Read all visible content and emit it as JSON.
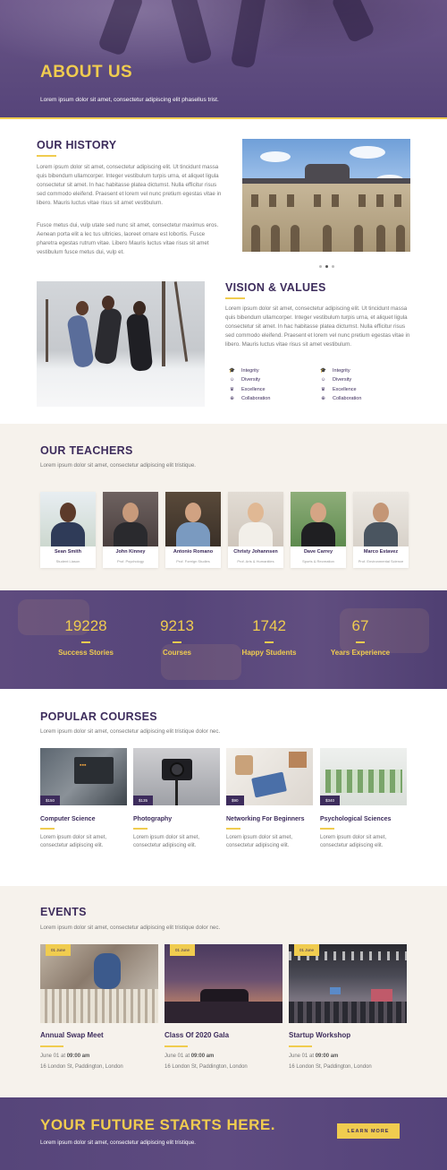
{
  "colors": {
    "accent": "#f0cc4f",
    "brand": "#3d2c5c"
  },
  "hero": {
    "title": "ABOUT US",
    "subtitle": "Lorem ipsum dolor sit amet, consectetur adipiscing elit phasellus trist."
  },
  "history": {
    "title": "OUR HISTORY",
    "p1": "Lorem ipsum dolor sit amet, consectetur adipiscing elit. Ut tincidunt massa quis bibendum ullamcorper. Integer vestibulum turpis urna, et aliquet ligula consectetur sit amet. In hac habitasse platea dictumst. Nulla efficitur risus sed commodo eleifend. Praesent et lorem vel nunc pretium egestas vitae in libero. Mauris luctus vitae risus sit amet vestibulum.",
    "p2": "Fusce metus dui, vulp utate sed nunc sit amet, consectetur maximus eros. Aenean porta elit a lec tus ultricies, laoreet ornare est lobortis. Fusce pharetra egestas rutrum vitae. Libero Mauris luctus vitae risus sit amet vestibulum fusce metus dui, vulp et."
  },
  "vision": {
    "title": "VISION & VALUES",
    "text": "Lorem ipsum dolor sit amet, consectetur adipiscing elit. Ut tincidunt massa quis bibendum ullamcorper. Integer vestibulum turpis urna, et aliquet ligula consectetur sit amet. In hac habitasse platea dictumst. Nulla efficitur risus sed commodo eleifend. Praesent et lorem vel nunc pretium egestas vitae in libero. Mauris luctus vitae risus sit amet vestibulum.",
    "values_left": [
      {
        "icon": "graduation-cap-icon",
        "label": "Integrity"
      },
      {
        "icon": "users-icon",
        "label": "Diversity"
      },
      {
        "icon": "trophy-icon",
        "label": "Excellence"
      },
      {
        "icon": "compass-icon",
        "label": "Collaboration"
      }
    ],
    "values_right": [
      {
        "icon": "graduation-cap-icon",
        "label": "Integrity"
      },
      {
        "icon": "users-icon",
        "label": "Diversity"
      },
      {
        "icon": "trophy-icon",
        "label": "Excellence"
      },
      {
        "icon": "compass-icon",
        "label": "Collaboration"
      }
    ]
  },
  "teachers": {
    "title": "OUR TEACHERS",
    "subtitle": "Lorem ipsum dolor sit amet, consectetur adipiscing elit tristique.",
    "items": [
      {
        "name": "Sean Smith",
        "role": "Student Liason"
      },
      {
        "name": "John Kinney",
        "role": "Prof. Psychology"
      },
      {
        "name": "Antonio Romano",
        "role": "Prof. Foreign Studies"
      },
      {
        "name": "Christy Johannsen",
        "role": "Prof. Arts & Humanities"
      },
      {
        "name": "Dave Carrey",
        "role": "Sports & Recreation"
      },
      {
        "name": "Marco Estavez",
        "role": "Prof. Environmental Science"
      }
    ]
  },
  "stats": [
    {
      "number": "19228",
      "label": "Success Stories"
    },
    {
      "number": "9213",
      "label": "Courses"
    },
    {
      "number": "1742",
      "label": "Happy Students"
    },
    {
      "number": "67",
      "label": "Years Experience"
    }
  ],
  "courses": {
    "title": "POPULAR COURSES",
    "subtitle": "Lorem ipsum dolor sit amet, consectetur adipiscing elit tristique dolor nec.",
    "items": [
      {
        "price": "$150",
        "title": "Computer Science",
        "desc": "Lorem ipsum dolor sit amet, consectetur adipiscing elit."
      },
      {
        "price": "$135",
        "title": "Photography",
        "desc": "Lorem ipsum dolor sit amet, consectetur adipiscing elit."
      },
      {
        "price": "$90",
        "title": "Networking For Beginners",
        "desc": "Lorem ipsum dolor sit amet, consectetur adipiscing elit."
      },
      {
        "price": "$340",
        "title": "Psychological Sciences",
        "desc": "Lorem ipsum dolor sit amet, consectetur adipiscing elit."
      }
    ]
  },
  "events": {
    "title": "EVENTS",
    "subtitle": "Lorem ipsum dolor sit amet, consectetur adipiscing elit tristique dolor nec.",
    "items": [
      {
        "badge": "01 June",
        "title": "Annual Swap Meet",
        "date_prefix": "June 01 at",
        "time": "09:00 am",
        "address": "16 London St, Paddington, London"
      },
      {
        "badge": "01 June",
        "title": "Class Of 2020 Gala",
        "date_prefix": "June 01 at",
        "time": "09:00 am",
        "address": "16 London St, Paddington, London"
      },
      {
        "badge": "01 June",
        "title": "Startup Workshop",
        "date_prefix": "June 01 at",
        "time": "09:00 am",
        "address": "16 London St, Paddington, London"
      }
    ]
  },
  "cta": {
    "title": "YOUR FUTURE STARTS HERE.",
    "subtitle": "Lorem ipsum dolor sit amet, consectetur adipiscing elit tristique.",
    "button": "LEARN MORE"
  }
}
